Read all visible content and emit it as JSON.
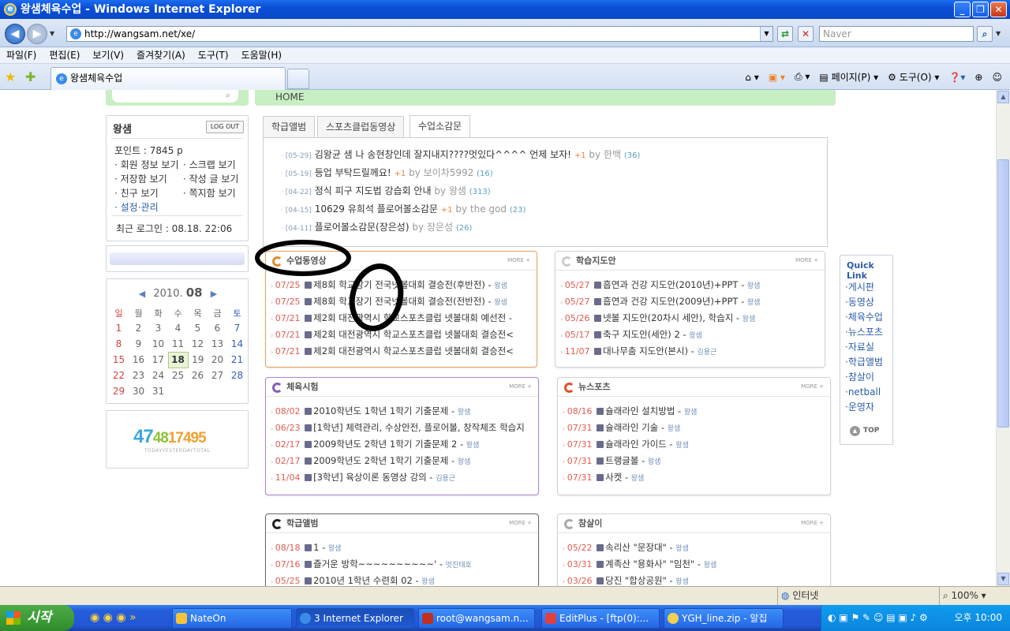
{
  "window": {
    "title": "왕샘체육수업 - Windows Internet Explorer",
    "url": "http://wangsam.net/xe/",
    "search_placeholder": "Naver",
    "tab_title": "왕샘체육수업"
  },
  "menu": [
    "파일(F)",
    "편집(E)",
    "보기(V)",
    "즐겨찾기(A)",
    "도구(T)",
    "도움말(H)"
  ],
  "commands": {
    "page": "페이지(P)",
    "tools": "도구(O)"
  },
  "site": {
    "breadcrumb": "HOME",
    "login": {
      "name": "왕샘",
      "logout": "LOG OUT",
      "points": "포인트 : 7845 p",
      "links": [
        "회원 정보 보기",
        "스크랩 보기",
        "저장함 보기",
        "작성 글 보기",
        "친구 보기",
        "쪽지함 보기",
        "설정·관리"
      ],
      "last_login": "최근 로그인 : 08.18. 22:06"
    },
    "calendar": {
      "year": "2010.",
      "month": "08",
      "weekdays": [
        "일",
        "월",
        "화",
        "수",
        "목",
        "금",
        "토"
      ],
      "weeks": [
        [
          "1",
          "2",
          "3",
          "4",
          "5",
          "6",
          "7"
        ],
        [
          "8",
          "9",
          "10",
          "11",
          "12",
          "13",
          "14"
        ],
        [
          "15",
          "16",
          "17",
          "18",
          "19",
          "20",
          "21"
        ],
        [
          "22",
          "23",
          "24",
          "25",
          "26",
          "27",
          "28"
        ],
        [
          "29",
          "30",
          "31",
          "",
          "",
          "",
          ""
        ]
      ],
      "today": "18"
    },
    "counter": {
      "today": "47",
      "yesterday": "48",
      "total": "17495",
      "caption": "TODAYYESTERDAYTOTAL"
    },
    "tabs": [
      "학급앨범",
      "스포츠클럽동영상",
      "수업소감문"
    ],
    "notices": [
      {
        "date": "[05-29]",
        "title": "김왕균 샘 나 송현창인데 잘지내지????멋있다^^^^ 언제 보자!",
        "plus": "+1",
        "by": "by 한백",
        "count": "(36)"
      },
      {
        "date": "[05-19]",
        "title": "등업 부탁드릴께요!",
        "plus": "+1",
        "by": "by 보이차5992",
        "count": "(16)"
      },
      {
        "date": "[04-22]",
        "title": "정식 피구 지도법 강습회 안내",
        "plus": "",
        "by": "by 왕샘",
        "count": "(313)"
      },
      {
        "date": "[04-15]",
        "title": "10629 유희석 플로어볼소감문",
        "plus": "+1",
        "by": "by the god",
        "count": "(23)"
      },
      {
        "date": "[04-11]",
        "title": "플로어볼소감문(장은성)",
        "plus": "",
        "by": "by 장은성",
        "count": "(26)"
      }
    ],
    "more": "MORE +",
    "panels": [
      {
        "title": "수업동영상",
        "rows": [
          [
            "07/25",
            "제8회 학교장기 전국넷볼대회 결승전(후반전)",
            "왕샘"
          ],
          [
            "07/25",
            "제8회 학교장기 전국넷볼대회 결승전(전반전)",
            "왕샘"
          ],
          [
            "07/21",
            "제2회 대전광역시 학교스포츠클럽 넷볼대회 예선전 -",
            ""
          ],
          [
            "07/21",
            "제2회 대전광역시 학교스포츠클럽 넷볼대회 결승전<",
            ""
          ],
          [
            "07/21",
            "제2회 대전광역시 학교스포츠클럽 넷볼대회 결승전<",
            ""
          ]
        ]
      },
      {
        "title": "학습지도안",
        "rows": [
          [
            "05/27",
            "흡연과 건강 지도안(2010년)+PPT",
            "왕샘"
          ],
          [
            "05/27",
            "흡연과 건강 지도안(2009년)+PPT",
            "왕샘"
          ],
          [
            "05/26",
            "넷볼 지도안(20차시 세안), 학습지",
            "왕샘"
          ],
          [
            "05/17",
            "축구 지도안(세안) 2",
            "왕샘"
          ],
          [
            "11/07",
            "대나무춤 지도안(본시)",
            "김용근"
          ]
        ]
      },
      {
        "title": "체육시험",
        "rows": [
          [
            "08/02",
            "2010학년도 1학년 1학기 기출문제",
            "왕샘"
          ],
          [
            "06/23",
            "[1학년] 체력관리, 수상안전, 플로어볼, 창작체조 학습지",
            ""
          ],
          [
            "02/17",
            "2009학년도 2학년 1학기 기출문제 2",
            "왕샘"
          ],
          [
            "02/17",
            "2009학년도 2학년 1학기 기출문제",
            "왕샘"
          ],
          [
            "11/04",
            "[3학년] 육상이론 동영상 강의",
            "김용근"
          ]
        ]
      },
      {
        "title": "뉴스포츠",
        "rows": [
          [
            "08/16",
            "슐래라인 설치방법",
            "왕샘"
          ],
          [
            "07/31",
            "슐래라인 기술",
            "왕샘"
          ],
          [
            "07/31",
            "슐래라인 가이드",
            "왕샘"
          ],
          [
            "07/31",
            "트랭글볼",
            "왕샘"
          ],
          [
            "07/31",
            "사켓",
            "왕샘"
          ]
        ]
      },
      {
        "title": "학급앨범",
        "rows": [
          [
            "08/18",
            "1",
            "왕샘"
          ],
          [
            "07/16",
            "즐거운 방학~~~~~~~~~~'",
            "멋진태호"
          ],
          [
            "05/25",
            "2010년 1학년 수련회 02",
            "왕샘"
          ]
        ]
      },
      {
        "title": "참살이",
        "rows": [
          [
            "05/22",
            "속리산 \"문장대\"",
            "왕샘"
          ],
          [
            "03/31",
            "계족산 \"용화사\" \"임천\"",
            "왕샘"
          ],
          [
            "03/26",
            "당진 \"합상공원\"",
            "왕샘"
          ]
        ]
      }
    ],
    "quicklink": {
      "title": "Quick Link",
      "items": [
        "게시판",
        "동영상",
        "체육수업",
        "뉴스포츠",
        "자료실",
        "학급앨범",
        "참살이",
        "netball",
        "운영자"
      ],
      "top": "TOP"
    }
  },
  "status": {
    "zone": "인터넷",
    "zoom": "100%"
  },
  "taskbar": {
    "start": "시작",
    "buttons": [
      "NateOn",
      "3 Internet Explorer",
      "root@wangsam.n...",
      "EditPlus - [ftp(0):...",
      "YGH_line.zip - 알집"
    ],
    "clock": "오후 10:00"
  },
  "colors": {
    "titlebar": "#0a4fd6",
    "accent": "#e88a2c",
    "link": "#2a5ca8"
  }
}
